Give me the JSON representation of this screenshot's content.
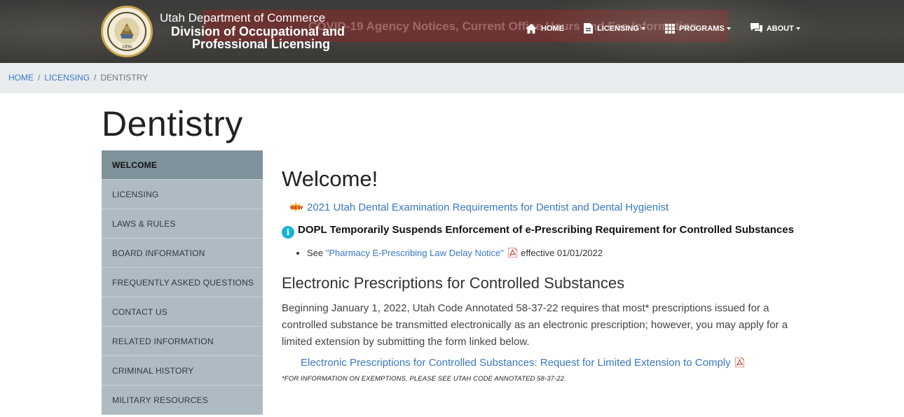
{
  "header": {
    "notice": "COVID-19 Agency Notices, Current Office Hours and Fee Information",
    "seal_year": "1896",
    "dept": "Utah Department of Commerce",
    "division_line1": "Division of Occupational and",
    "division_line2": "Professional Licensing",
    "nav": {
      "home": "HOME",
      "licensing": "LICENSING",
      "programs": "PROGRAMS",
      "about": "ABOUT"
    }
  },
  "breadcrumb": {
    "home": "HOME",
    "licensing": "LICENSING",
    "current": "DENTISTRY",
    "sep": "/"
  },
  "page_title": "Dentistry",
  "sidebar": {
    "items": [
      {
        "label": "WELCOME"
      },
      {
        "label": "LICENSING"
      },
      {
        "label": "LAWS & RULES"
      },
      {
        "label": "BOARD INFORMATION"
      },
      {
        "label": "FREQUENTLY ASKED QUESTIONS"
      },
      {
        "label": "CONTACT US"
      },
      {
        "label": "RELATED INFORMATION"
      },
      {
        "label": "CRIMINAL HISTORY"
      },
      {
        "label": "MILITARY RESOURCES"
      }
    ]
  },
  "main": {
    "welcome": "Welcome!",
    "new_link": "2021 Utah Dental Examination Requirements for Dentist and Dental Hygienist",
    "info_icon": "i",
    "info_heading": "DOPL Temporarily Suspends Enforcement of e-Prescribing Requirement for Controlled Substances",
    "bullet_see": "See ",
    "bullet_link": "\"Pharmacy E-Prescribing Law Delay Notice\"",
    "bullet_effective": " effective 01/01/2022",
    "section_heading": "Electronic Prescriptions for Controlled Substances",
    "paragraph": "Beginning January 1, 2022, Utah Code Annotated 58-37-22 requires that most* prescriptions issued for a controlled substance be transmitted electronically as an electronic prescription; however, you may apply for a limited extension by submitting the form linked below.",
    "extension_link": "Electronic Prescriptions for Controlled Substances: Request for Limited Extension to Comply",
    "footnote": "*FOR INFORMATION ON EXEMPTIONS, PLEASE SEE UTAH CODE ANNOTATED 58-37-22."
  },
  "colors": {
    "link": "#3a78c2",
    "sidebar_bg": "#aebbc2",
    "sidebar_active": "#7f929b",
    "info": "#17b3d6"
  }
}
